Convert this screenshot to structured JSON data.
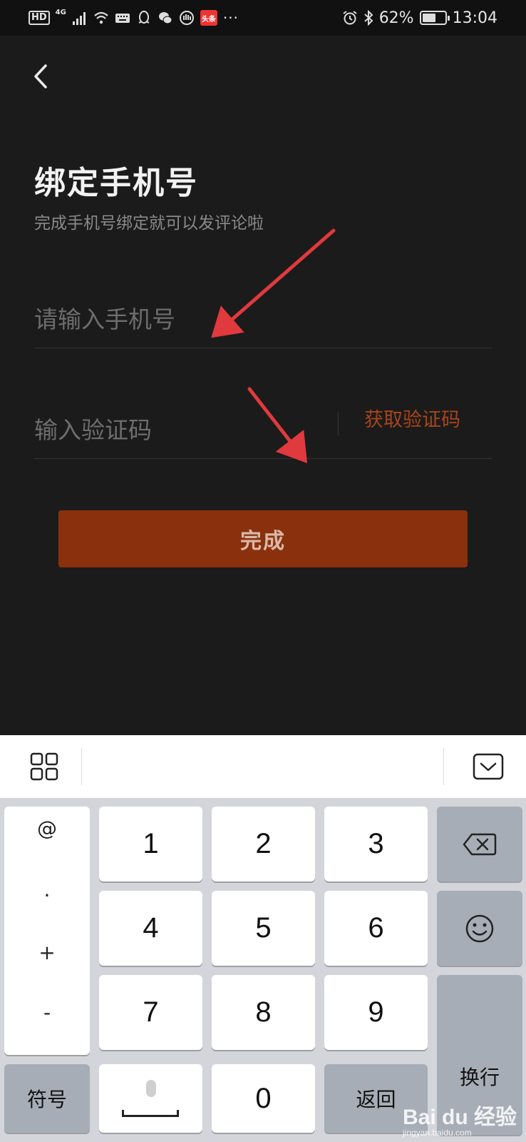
{
  "status_bar": {
    "hd": "HD",
    "network": "4G",
    "battery_percent": "62%",
    "battery_level": 0.62,
    "time": "13:04",
    "toutiao_badge": "头条",
    "more": "···"
  },
  "page": {
    "title": "绑定手机号",
    "subtitle": "完成手机号绑定就可以发评论啦",
    "phone_placeholder": "请输入手机号",
    "code_placeholder": "输入验证码",
    "get_code_label": "获取验证码",
    "done_label": "完成"
  },
  "keyboard": {
    "symbols": [
      "@",
      ".",
      "+",
      "-"
    ],
    "digits": [
      "1",
      "2",
      "3",
      "4",
      "5",
      "6",
      "7",
      "8",
      "9",
      "0"
    ],
    "symbol_key_label": "符号",
    "return_key_label": "返回",
    "enter_key_label": "换行"
  },
  "watermark": {
    "brand": "Bai du 经验",
    "url": "jingyan.baidu.com"
  },
  "colors": {
    "background": "#1b1b1b",
    "accent": "#a74519",
    "button": "#8a300d",
    "annotation_arrow": "#e0393e"
  }
}
